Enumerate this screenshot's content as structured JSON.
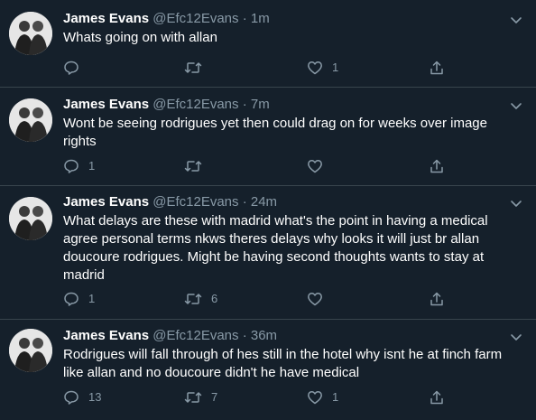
{
  "tweets": [
    {
      "name": "James Evans",
      "handle": "@Efc12Evans",
      "dot": "·",
      "time": "1m",
      "text": "Whats going on with allan",
      "reply_count": "",
      "retweet_count": "",
      "like_count": "1"
    },
    {
      "name": "James Evans",
      "handle": "@Efc12Evans",
      "dot": "·",
      "time": "7m",
      "text": "Wont be seeing rodrigues yet then could drag on for weeks over image rights",
      "reply_count": "1",
      "retweet_count": "",
      "like_count": ""
    },
    {
      "name": "James Evans",
      "handle": "@Efc12Evans",
      "dot": "·",
      "time": "24m",
      "text": "What delays are these with madrid what's the point in having a medical agree personal terms nkws theres delays why looks it will just br allan doucoure rodrigues. Might be having second thoughts wants to stay at madrid",
      "reply_count": "1",
      "retweet_count": "6",
      "like_count": ""
    },
    {
      "name": "James Evans",
      "handle": "@Efc12Evans",
      "dot": "·",
      "time": "36m",
      "text": "Rodrigues will fall through of hes still in the hotel why isnt he at finch farm like allan and no doucoure didn't he have medical",
      "reply_count": "13",
      "retweet_count": "7",
      "like_count": "1"
    }
  ],
  "icons": {
    "reply": "reply-icon",
    "retweet": "retweet-icon",
    "like": "like-icon",
    "share": "share-icon",
    "more": "chevron-down-icon",
    "avatar": "avatar"
  },
  "colors": {
    "background": "#15202b",
    "divider": "#38444d",
    "secondary_text": "#8899a6",
    "primary_text": "#ffffff"
  }
}
